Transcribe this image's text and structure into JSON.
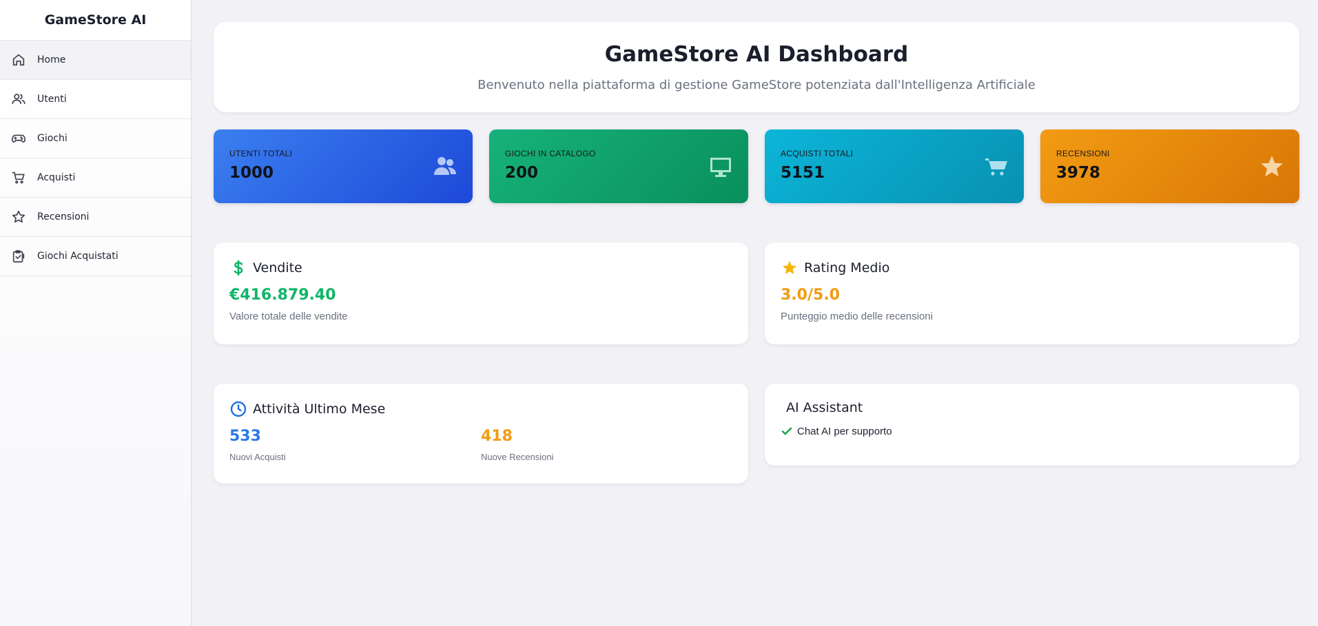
{
  "sidebar": {
    "brand": "GameStore AI",
    "items": [
      {
        "label": "Home",
        "icon": "home-icon"
      },
      {
        "label": "Utenti",
        "icon": "users-icon"
      },
      {
        "label": "Giochi",
        "icon": "gamepad-icon"
      },
      {
        "label": "Acquisti",
        "icon": "cart-icon"
      },
      {
        "label": "Recensioni",
        "icon": "star-icon"
      },
      {
        "label": "Giochi Acquistati",
        "icon": "clipboard-check-icon"
      }
    ]
  },
  "header": {
    "title": "GameStore AI Dashboard",
    "subtitle": "Benvenuto nella piattaforma di gestione GameStore potenziata dall'Intelligenza Artificiale"
  },
  "stats": [
    {
      "label": "UTENTI TOTALI",
      "value": "1000",
      "icon": "users-icon",
      "color": "#2563eb"
    },
    {
      "label": "GIOCHI IN CATALOGO",
      "value": "200",
      "icon": "monitor-icon",
      "color": "#10a36c"
    },
    {
      "label": "ACQUISTI TOTALI",
      "value": "5151",
      "icon": "cart-icon",
      "color": "#06a3c6"
    },
    {
      "label": "RECENSIONI",
      "value": "3978",
      "icon": "star-icon",
      "color": "#e88c0c"
    }
  ],
  "sales": {
    "title": "Vendite",
    "value": "€416.879.40",
    "caption": "Valore totale delle vendite",
    "color": "#10b569"
  },
  "rating": {
    "title": "Rating Medio",
    "value": "3.0/5.0",
    "caption": "Punteggio medio delle recensioni",
    "color": "#f29b13"
  },
  "activity": {
    "title": "Attività Ultimo Mese",
    "purchases_value": "533",
    "purchases_label": "Nuovi Acquisti",
    "reviews_value": "418",
    "reviews_label": "Nuove Recensioni"
  },
  "assistant": {
    "title": "AI Assistant",
    "feature": "Chat AI per supporto"
  }
}
